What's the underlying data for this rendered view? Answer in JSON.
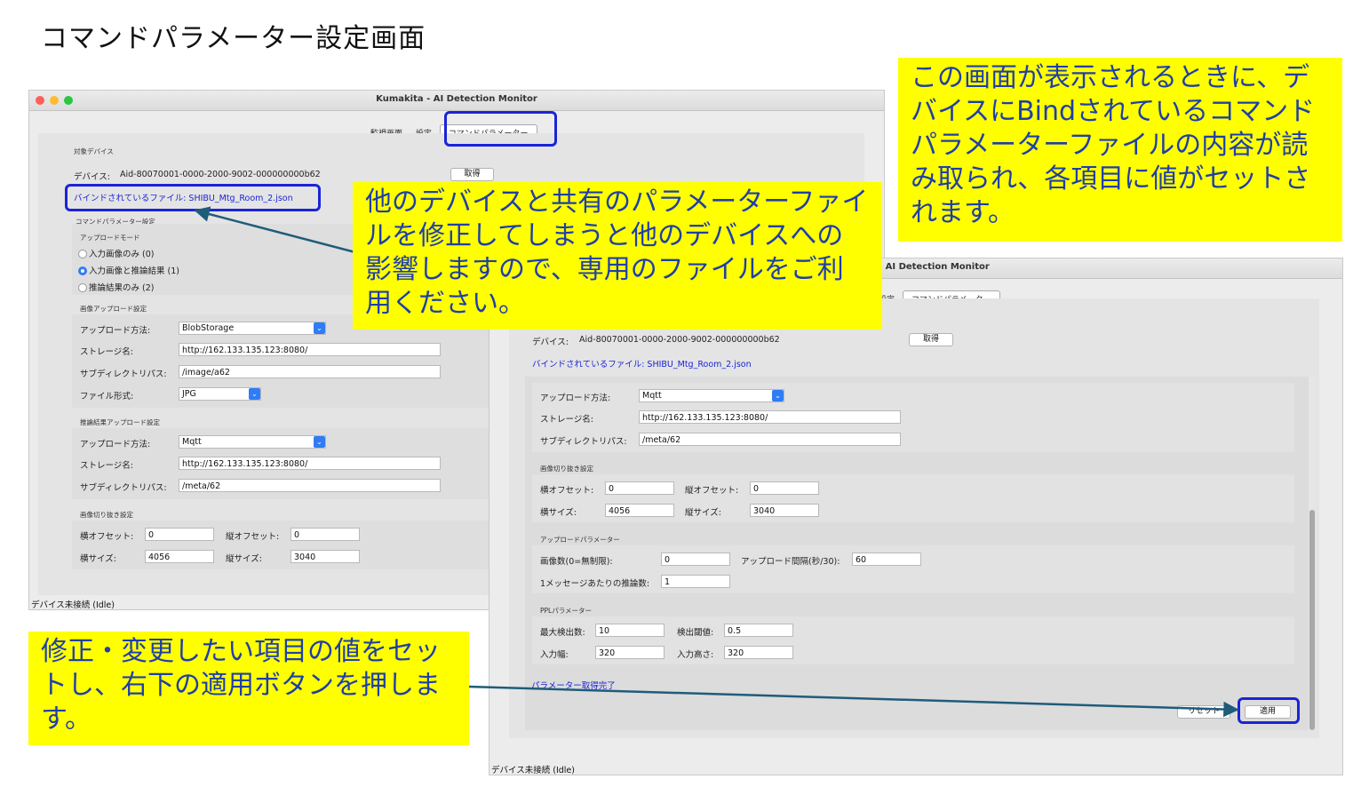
{
  "page_title": "コマンドパラメーター設定画面",
  "colors": {
    "callout_bg": "#ffff00",
    "callout_text": "#1f3fa8",
    "highlight": "#1a24d6",
    "link": "#1a24d6",
    "arrow": "#1f5c7a"
  },
  "icons": {
    "window_buttons": [
      "close-dot-icon",
      "minimize-dot-icon",
      "zoom-dot-icon"
    ],
    "select_arrow": "chevron-updown-icon"
  },
  "win1": {
    "title": "Kumakita - AI Detection Monitor",
    "tabs": [
      "監視画面",
      "設定",
      "コマンドパラメーター"
    ],
    "section_device": "対象デバイス",
    "device_label": "デバイス:",
    "device_value": "Aid-80070001-0000-2000-9002-000000000b62",
    "get_button": "取得",
    "bound_file": "バインドされているファイル: SHIBU_Mtg_Room_2.json",
    "section_cmd": "コマンドパラメーター設定",
    "upload_mode_title": "アップロードモード",
    "radio": [
      "入力画像のみ (0)",
      "入力画像と推論結果 (1)",
      "推論結果のみ (2)"
    ],
    "image_upload_title": "画像アップロード設定",
    "upload_method_label": "アップロード方法:",
    "upload_method_value": "BlobStorage",
    "storage_label": "ストレージ名:",
    "storage_value": "http://162.133.135.123:8080/",
    "subdir_label": "サブディレクトリパス:",
    "subdir_value": "/image/a62",
    "file_format_label": "ファイル形式:",
    "file_format_value": "JPG",
    "inference_upload_title": "推論結果アップロード設定",
    "inf_method_value": "Mqtt",
    "inf_storage_value": "http://162.133.135.123:8080/",
    "inf_subdir_value": "/meta/62",
    "crop_title": "画像切り抜き設定",
    "h_offset_label": "横オフセット:",
    "h_offset_value": "0",
    "v_offset_label": "縦オフセット:",
    "v_offset_value": "0",
    "h_size_label": "横サイズ:",
    "h_size_value": "4056",
    "v_size_label": "縦サイズ:",
    "v_size_value": "3040",
    "status": "デバイス未接続 (Idle)"
  },
  "win2": {
    "title": "- AI Detection Monitor",
    "tabs": [
      "設定",
      "コマンドパラメーター"
    ],
    "device_label": "デバイス:",
    "device_value": "Aid-80070001-0000-2000-9002-000000000b62",
    "get_button": "取得",
    "bound_file": "バインドされているファイル: SHIBU_Mtg_Room_2.json",
    "upload_method_label": "アップロード方法:",
    "upload_method_value": "Mqtt",
    "storage_label": "ストレージ名:",
    "storage_value": "http://162.133.135.123:8080/",
    "subdir_label": "サブディレクトリパス:",
    "subdir_value": "/meta/62",
    "crop_title": "画像切り抜き設定",
    "h_offset_label": "横オフセット:",
    "h_offset_value": "0",
    "v_offset_label": "縦オフセット:",
    "v_offset_value": "0",
    "h_size_label": "横サイズ:",
    "h_size_value": "4056",
    "v_size_label": "縦サイズ:",
    "v_size_value": "3040",
    "upload_params_title": "アップロードパラメーター",
    "image_count_label": "画像数(0=無制限):",
    "image_count_value": "0",
    "interval_label": "アップロード間隔(秒/30):",
    "interval_value": "60",
    "per_msg_label": "1メッセージあたりの推論数:",
    "per_msg_value": "1",
    "ppl_title": "PPLパラメーター",
    "max_detect_label": "最大検出数:",
    "max_detect_value": "10",
    "threshold_label": "検出閾値:",
    "threshold_value": "0.5",
    "in_width_label": "入力幅:",
    "in_width_value": "320",
    "in_height_label": "入力高さ:",
    "in_height_value": "320",
    "param_status": "パラメーター取得完了",
    "reset_button": "リセット",
    "apply_button": "適用",
    "status": "デバイス未接続 (Idle)"
  },
  "callouts": {
    "top_right": "この画面が表示されるときに、デバイスにBindされているコマンドパラメーターファイルの内容が読み取られ、各項目に値がセットされます。",
    "middle": "他のデバイスと共有のパラメーターファイルを修正してしまうと他のデバイスへの影響しますので、専用のファイルをご利用ください。",
    "bottom_left": "修正・変更したい項目の値をセットし、右下の適用ボタンを押します。"
  }
}
